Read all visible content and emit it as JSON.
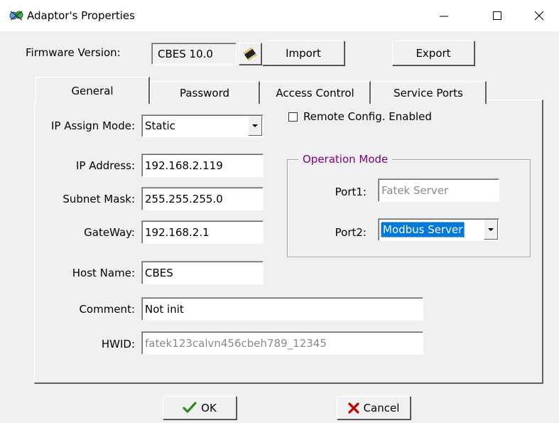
{
  "window": {
    "title": "Adaptor's Properties",
    "minimize_glyph": "—",
    "maximize_glyph": "☐",
    "close_glyph": "✕"
  },
  "firmware": {
    "label": "Firmware Version:",
    "value": "CBES 10.0",
    "chip_icon": "chip-icon",
    "import_label": "Import",
    "export_label": "Export"
  },
  "tabs": [
    {
      "label": "General"
    },
    {
      "label": "Password"
    },
    {
      "label": "Access Control"
    },
    {
      "label": "Service Ports"
    }
  ],
  "general": {
    "ip_assign_label": "IP Assign Mode:",
    "ip_assign_value": "Static",
    "remote_config_label": "Remote Config. Enabled",
    "remote_config_checked": false,
    "ip_address_label": "IP Address:",
    "ip_address_value": "192.168.2.119",
    "subnet_label": "Subnet Mask:",
    "subnet_value": "255.255.255.0",
    "gateway_label": "GateWay:",
    "gateway_value": "192.168.2.1",
    "hostname_label": "Host Name:",
    "hostname_value": "CBES",
    "comment_label": "Comment:",
    "comment_value": "Not init",
    "hwid_label": "HWID:",
    "hwid_value": "fatek123calvn456cbeh789_12345"
  },
  "operation_mode": {
    "title": "Operation Mode",
    "port1_label": "Port1:",
    "port1_value": "Fatek Server",
    "port2_label": "Port2:",
    "port2_value": "Modbus Server"
  },
  "footer": {
    "ok_label": "OK",
    "cancel_label": "Cancel"
  },
  "colors": {
    "group_title": "#800080",
    "selection": "#0078d7",
    "ok_check": "#2e8b1e",
    "cancel_x": "#c00000"
  }
}
